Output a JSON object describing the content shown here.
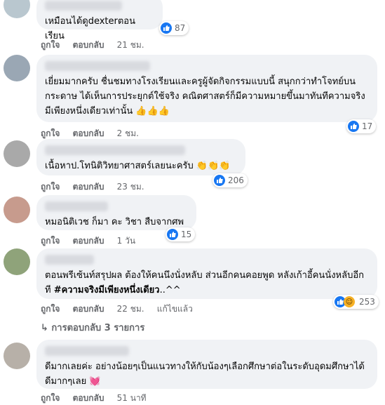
{
  "comments": [
    {
      "text": "เหมือนได้ดูdexterตอนเรียน",
      "like_label": "ถูกใจ",
      "reply_label": "ตอบกลับ",
      "time": "21 ชม.",
      "reactions": "87"
    },
    {
      "text": "เยี่ยมมากครับ ชื่นชมทางโรงเรียนและครูผู้จัดกิจกรรมแบบนี้ สนุกกว่าทำโจทย์บนกระดาษ ได้เห็นการประยุกต์ใช้จริง คณิตศาสตร์ก็มีความหมายขึ้นมาทันทีความจริงมีเพียงหนึ่งเดียวเท่านั้น 👍👍👍",
      "like_label": "ถูกใจ",
      "reply_label": "ตอบกลับ",
      "time": "2 ชม.",
      "reactions": "17"
    },
    {
      "text": "เนื้อหาป.โทนิติวิทยาศาสตร์เลยนะครับ 👏👏👏",
      "like_label": "ถูกใจ",
      "reply_label": "ตอบกลับ",
      "time": "23 ชม.",
      "reactions": "206"
    },
    {
      "text": "หมอนิติเวช ก็มา คะ วิชา สืบจากศพ",
      "like_label": "ถูกใจ",
      "reply_label": "ตอบกลับ",
      "time": "1 วัน",
      "reactions": "15"
    },
    {
      "text_a": "ตอนพรีเซ้นท์สรุปผล ต้องให้คนนึงนั่งหลับ ส่วนอีกคนคอยพูด หลังเก้าอี้คนนั่งหลับอีกที ",
      "hashtag": "#ความจริงมีเพียงหนึ่งเดียว",
      "text_b": "..^^",
      "like_label": "ถูกใจ",
      "reply_label": "ตอบกลับ",
      "time": "22 ชม.",
      "edited": "แก้ไขแล้ว",
      "reactions": "253"
    },
    {
      "text": "ดีมากเลยค่ะ อย่างน้อยๆเป็นแนวทางให้กับน้องๆเลือกศึกษาต่อในระดับอุดมศึกษาได้ดีมากๆเลย 💓",
      "like_label": "ถูกใจ",
      "reply_label": "ตอบกลับ",
      "time": "51 นาที"
    }
  ],
  "view_replies": "↳ การตอบกลับ 3 รายการ",
  "colors": {
    "bubble": "#f0f2f5",
    "like_blue": "#1877f2",
    "meta_gray": "#65676b"
  }
}
